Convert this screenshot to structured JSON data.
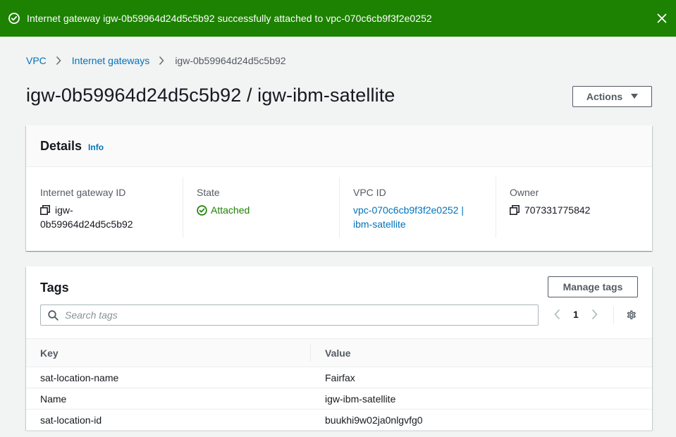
{
  "flash": {
    "message": "Internet gateway igw-0b59964d24d5c5b92 successfully attached to vpc-070c6cb9f3f2e0252",
    "color": "#1d8102"
  },
  "breadcrumb": {
    "items": [
      "VPC",
      "Internet gateways"
    ],
    "current": "igw-0b59964d24d5c5b92"
  },
  "page": {
    "title": "igw-0b59964d24d5c5b92 / igw-ibm-satellite",
    "actions_label": "Actions"
  },
  "details": {
    "title": "Details",
    "info_label": "Info",
    "gateway_id_label": "Internet gateway ID",
    "gateway_id_line1": "igw-",
    "gateway_id_line2": "0b59964d24d5c5b92",
    "state_label": "State",
    "state_value": "Attached",
    "vpc_label": "VPC ID",
    "vpc_line1": "vpc-070c6cb9f3f2e0252 |",
    "vpc_line2": "ibm-satellite",
    "owner_label": "Owner",
    "owner_value": "707331775842"
  },
  "tags": {
    "title": "Tags",
    "manage_label": "Manage tags",
    "search_placeholder": "Search tags",
    "page": "1",
    "columns": [
      "Key",
      "Value"
    ],
    "rows": [
      {
        "key": "sat-location-name",
        "value": "Fairfax"
      },
      {
        "key": "Name",
        "value": "igw-ibm-satellite"
      },
      {
        "key": "sat-location-id",
        "value": "buukhi9w02ja0nlgvfg0"
      }
    ]
  },
  "colors": {
    "link": "#0073bb",
    "success": "#1d8102",
    "background": "#f2f3f3"
  }
}
